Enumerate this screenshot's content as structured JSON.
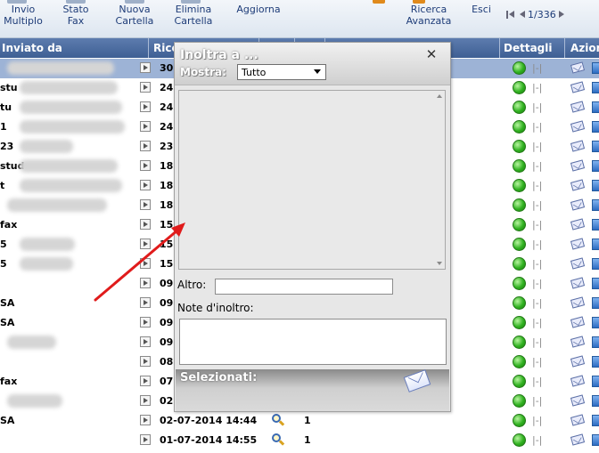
{
  "toolbar": {
    "buttons": [
      {
        "label": "Invio\nMultiplo"
      },
      {
        "label": "Stato\nFax"
      },
      {
        "label": "Nuova\nCartella"
      },
      {
        "label": "Elimina\nCartella"
      },
      {
        "label": "Aggiorna"
      },
      {
        "label": "Ricerca\nAvanzata"
      },
      {
        "label": "Esci"
      }
    ],
    "page_indicator": "1/336"
  },
  "table": {
    "headers": {
      "from": "Inviato da",
      "received": "Rice",
      "details": "Dettagli",
      "actions": "Azioni"
    },
    "rows": [
      {
        "from": "",
        "date": "30",
        "count": "",
        "selected": true
      },
      {
        "from": "stu",
        "date": "24",
        "count": ""
      },
      {
        "from": "tu",
        "date": "24",
        "count": ""
      },
      {
        "from": "1",
        "date": "24",
        "count": ""
      },
      {
        "from": "23",
        "date": "23",
        "count": ""
      },
      {
        "from": "stud",
        "date": "18",
        "count": ""
      },
      {
        "from": "t",
        "date": "18",
        "count": ""
      },
      {
        "from": "",
        "date": "18",
        "count": ""
      },
      {
        "from": "fax",
        "date": "15",
        "count": ""
      },
      {
        "from": "5",
        "date": "15",
        "count": ""
      },
      {
        "from": "5",
        "date": "15",
        "count": ""
      },
      {
        "from": "",
        "date": "09",
        "count": ""
      },
      {
        "from": "SA",
        "date": "09",
        "count": ""
      },
      {
        "from": "SA",
        "date": "09",
        "count": ""
      },
      {
        "from": "",
        "date": "09",
        "count": ""
      },
      {
        "from": "",
        "date": "08",
        "count": ""
      },
      {
        "from": "fax",
        "date": "07",
        "count": ""
      },
      {
        "from": "",
        "date": "02",
        "count": ""
      },
      {
        "from": "SA",
        "date": "02-07-2014 14:44",
        "count": "1"
      },
      {
        "from": "",
        "date": "01-07-2014 14:55",
        "count": "1"
      }
    ],
    "detail_text": "|-|"
  },
  "modal": {
    "title": "Inoltra a ...",
    "close_symbol": "✕",
    "show_label": "Mostra:",
    "show_value": "Tutto",
    "other_label": "Altro:",
    "other_value": "",
    "notes_label": "Note d'inoltro:",
    "notes_value": "",
    "selected_label": "Selezionati:"
  },
  "colors": {
    "header_bg": "#4a6aa0",
    "selected_row": "#9db3d6",
    "status_green": "#2fb11f",
    "annotation_arrow": "#e01b1b"
  },
  "icons": [
    "search-icon",
    "status-dot-icon",
    "envelope-icon",
    "document-icon",
    "send-envelope-icon",
    "close-icon",
    "first-page-icon",
    "prev-page-icon",
    "next-page-icon"
  ]
}
